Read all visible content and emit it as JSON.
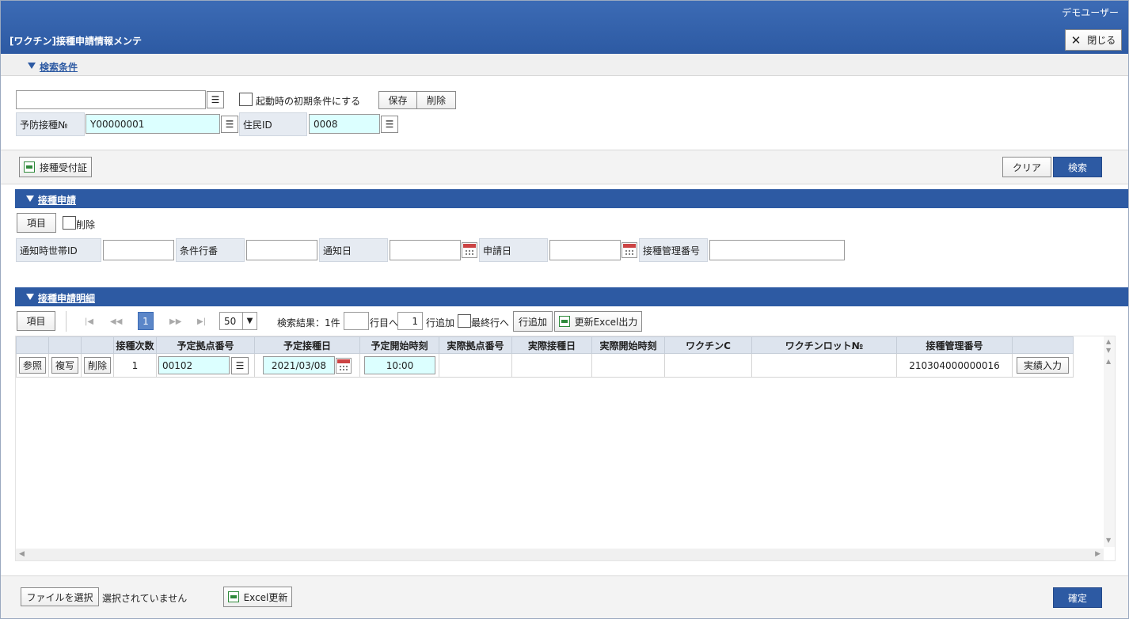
{
  "header": {
    "user": "デモユーザー",
    "title": "[ワクチン]接種申請情報メンテ",
    "close_label": "閉じる"
  },
  "search": {
    "section_title": "検索条件",
    "saved_condition_value": "",
    "startup_default_label": "起動時の初期条件にする",
    "save_label": "保存",
    "delete_label": "削除",
    "vaccination_no_label": "予防接種№",
    "vaccination_no_value": "Y00000001",
    "resident_id_label": "住民ID",
    "resident_id_value": "0008"
  },
  "toolbar": {
    "receipt_label": "接種受付証",
    "clear_label": "クリア",
    "search_label": "検索"
  },
  "application": {
    "section_title": "接種申請",
    "item_label": "項目",
    "delete_label": "削除",
    "fields": [
      {
        "label": "通知時世帯ID",
        "value": ""
      },
      {
        "label": "条件行番",
        "value": ""
      },
      {
        "label": "通知日",
        "value": ""
      },
      {
        "label": "申請日",
        "value": ""
      },
      {
        "label": "接種管理番号",
        "value": ""
      }
    ]
  },
  "details": {
    "section_title": "接種申請明細",
    "item_label": "項目",
    "current_page": "1",
    "page_size": "50",
    "result_text": "検索結果：1件",
    "goto_value": "",
    "goto_label": "行目へ",
    "add_count": "1",
    "add_label": "行追加",
    "last_row_label": "最終行へ",
    "add_row_label": "行追加",
    "excel_export_label": "更新Excel出力",
    "columns": [
      "接種次数",
      "予定拠点番号",
      "予定接種日",
      "予定開始時刻",
      "実際拠点番号",
      "実際接種日",
      "実際開始時刻",
      "ワクチンC",
      "ワクチンロット№",
      "接種管理番号"
    ],
    "row_buttons": [
      "参照",
      "複写",
      "削除"
    ],
    "rows": [
      {
        "dose": "1",
        "planned_site": "00102",
        "planned_date": "2021/03/08",
        "planned_time": "10:00",
        "actual_site": "",
        "actual_date": "",
        "actual_time": "",
        "vaccine_c": "",
        "lot_no": "",
        "management_no": "210304000000016",
        "result_button": "実績入力"
      }
    ]
  },
  "footer": {
    "file_button": "ファイルを選択",
    "file_status": "選択されていません",
    "excel_update": "Excel更新",
    "confirm": "確定"
  }
}
